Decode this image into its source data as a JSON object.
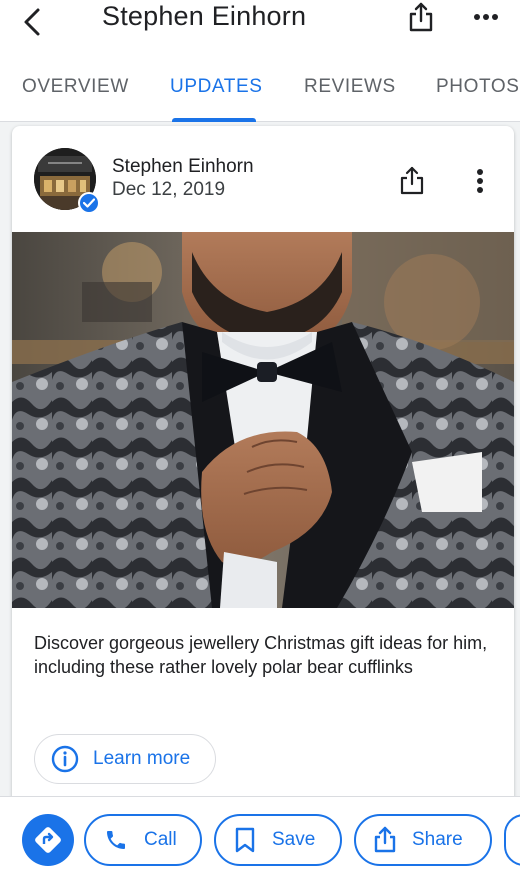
{
  "header": {
    "title": "Stephen Einhorn",
    "back_icon": "chevron-left-icon",
    "share_icon": "share-icon",
    "more_icon": "more-horizontal-icon"
  },
  "tabs": [
    {
      "label": "OVERVIEW",
      "active": false
    },
    {
      "label": "UPDATES",
      "active": true
    },
    {
      "label": "REVIEWS",
      "active": false
    },
    {
      "label": "PHOTOS",
      "active": false
    }
  ],
  "post": {
    "author": "Stephen Einhorn",
    "date": "Dec 12, 2019",
    "verified": true,
    "text": "Discover gorgeous jewellery Christmas gift ideas for him, including these rather lovely polar bear cufflinks",
    "cta_label": "Learn more",
    "cta_icon": "info-icon"
  },
  "actions": {
    "directions_icon": "directions-icon",
    "call_label": "Call",
    "save_label": "Save",
    "share_label": "Share"
  },
  "colors": {
    "accent": "#1a73e8",
    "text": "#202124",
    "muted": "#5f6368"
  }
}
